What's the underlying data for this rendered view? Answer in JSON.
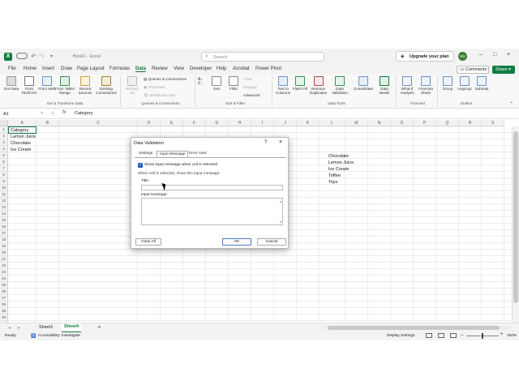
{
  "title_bar": {
    "autosave": "AutoSave",
    "doc_name": "Book1 - Excel",
    "search_placeholder": "Search",
    "upgrade_label": "Upgrade your plan",
    "avatar_initials": "MV"
  },
  "menu": {
    "items": [
      "File",
      "Home",
      "Insert",
      "Draw",
      "Page Layout",
      "Formulas",
      "Data",
      "Review",
      "View",
      "Developer",
      "Help",
      "Acrobat",
      "Power Pivot"
    ],
    "active": "Data",
    "comments_label": "Comments",
    "share_label": "Share"
  },
  "ribbon": {
    "get_data": "Get Data",
    "from_text_csv": "From Text/CSV",
    "from_web": "From Web",
    "from_table_range": "From Table/ Range",
    "recent_sources": "Recent Sources",
    "existing_connections": "Existing Connections",
    "refresh_all": "Refresh All",
    "queries_connections": "Queries & Connections",
    "properties": "Properties",
    "workbook_links": "Workbook Links",
    "sort": "Sort",
    "filter": "Filter",
    "clear": "Clear",
    "reapply": "Reapply",
    "advanced": "Advanced",
    "text_to_columns": "Text to Columns",
    "flash_fill": "Flash Fill",
    "remove_duplicates": "Remove Duplicates",
    "data_validation": "Data Validation",
    "consolidate": "Consolidate",
    "data_model": "Data Model",
    "what_if_analysis": "What-If Analysis",
    "forecast_sheet": "Forecast Sheet",
    "group": "Group",
    "ungroup": "Ungroup",
    "subtotal": "Subtotal",
    "groups": {
      "get_transform": "Get & Transform Data",
      "queries": "Queries & Connections",
      "sort_filter": "Sort & Filter",
      "data_tools": "Data Tools",
      "forecast": "Forecast",
      "outline": "Outline"
    }
  },
  "formula_bar": {
    "name_box": "A1",
    "fx": "fx",
    "value": "Category"
  },
  "grid": {
    "columns": [
      "A",
      "B",
      "C",
      "D",
      "E",
      "F",
      "G",
      "H",
      "I",
      "J",
      "K",
      "L",
      "M",
      "N",
      "O",
      "P",
      "Q",
      "R",
      "S"
    ],
    "rows": [
      "1",
      "2",
      "3",
      "4",
      "5",
      "6",
      "7",
      "8",
      "9",
      "10",
      "11",
      "12",
      "13",
      "14",
      "15",
      "16",
      "17",
      "18",
      "19",
      "20",
      "21",
      "22",
      "23",
      "24",
      "25",
      "26",
      "27",
      "28",
      "29",
      "30",
      "31",
      "32",
      "33",
      "34",
      "35",
      "36",
      "37"
    ],
    "col_a": [
      "Category",
      "Lemon Juice",
      "Chocolate",
      "Ice Cream"
    ],
    "col_l": [
      "Chocolate",
      "Lemon Juice",
      "Ice Cream",
      "Toffee",
      "Toys"
    ]
  },
  "dialog": {
    "title": "Data Validation",
    "help": "?",
    "close": "×",
    "tabs": [
      "Settings",
      "Input Message",
      "Error Alert"
    ],
    "active_tab": "Input Message",
    "checkbox_label": "Show input message when cell is selected",
    "section_label": "When cell is selected, show this input message:",
    "title_label": "Title:",
    "message_label": "Input message:",
    "clear_all": "Clear All",
    "ok": "OK",
    "cancel": "Cancel"
  },
  "sheets": {
    "tabs": [
      "Sheet1",
      "Sheet4"
    ],
    "active": "Sheet4",
    "add": "+"
  },
  "status": {
    "ready": "Ready",
    "accessibility": "Accessibility: Investigate",
    "display_settings": "Display Settings",
    "zoom": "100%"
  },
  "colors": {
    "accent": "#107c41",
    "checkbox": "#1f5fbf"
  }
}
